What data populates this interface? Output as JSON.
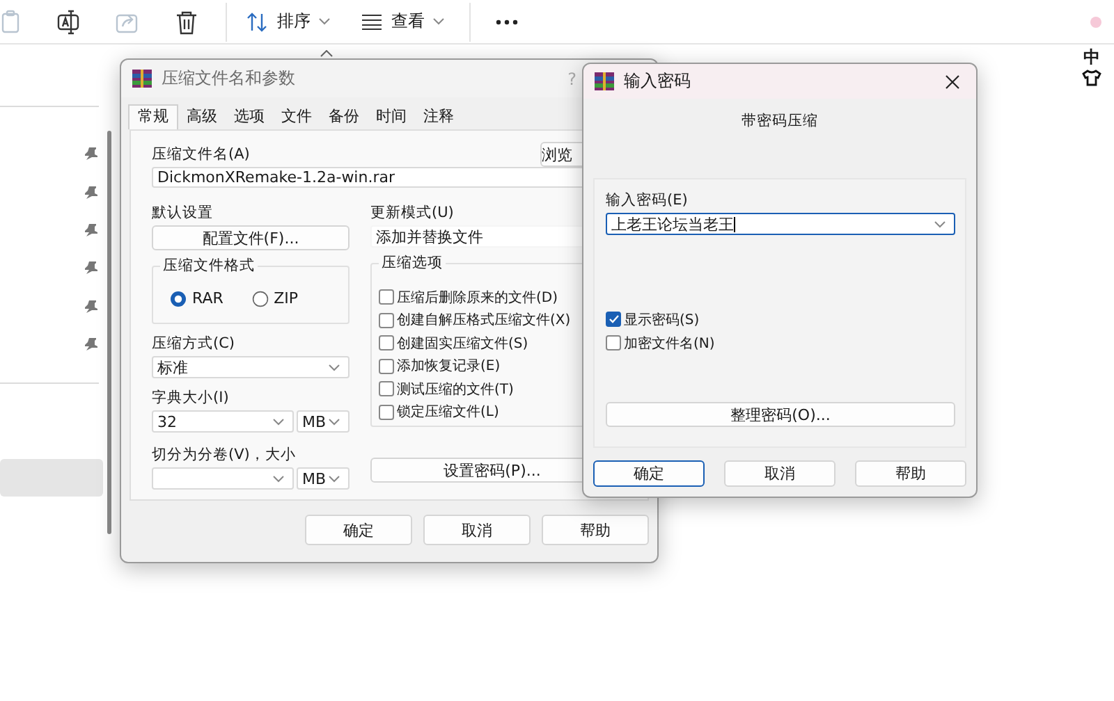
{
  "explorer": {
    "toolbar": {
      "buttons": [
        {
          "kind": "paste",
          "disabled": true
        },
        {
          "kind": "rename",
          "disabled": false
        },
        {
          "kind": "share",
          "disabled": true
        },
        {
          "kind": "delete",
          "disabled": false
        }
      ],
      "sort": "排序",
      "view": "查看"
    },
    "nav_pane": {
      "pinned_items": [
        {
          "pinned": true
        },
        {
          "pinned": true
        },
        {
          "pinned": true
        },
        {
          "pinned": true
        },
        {
          "pinned": true
        },
        {
          "pinned": true
        }
      ],
      "items": [
        {
          "selected": false
        },
        {
          "selected": false
        },
        {
          "selected": true
        }
      ]
    },
    "ime_indicator": "中"
  },
  "archive_dialog": {
    "title": "压缩文件名和参数",
    "help_mark": "?",
    "tabs": [
      {
        "label": "常规",
        "selected": true
      },
      {
        "label": "高级",
        "selected": false
      },
      {
        "label": "选项",
        "selected": false
      },
      {
        "label": "文件",
        "selected": false
      },
      {
        "label": "备份",
        "selected": false
      },
      {
        "label": "时间",
        "selected": false
      },
      {
        "label": "注释",
        "selected": false
      }
    ],
    "archive_name": {
      "label": "压缩文件名(A)",
      "value": "DickmonXRemake-1.2a-win.rar",
      "browse": "浏览"
    },
    "default_settings": {
      "label": "默认设置",
      "button": "配置文件(F)..."
    },
    "update_mode": {
      "label": "更新模式(U)",
      "value": "添加并替换文件"
    },
    "archive_format": {
      "title": "压缩文件格式",
      "options": [
        {
          "label": "RAR",
          "selected": true
        },
        {
          "label": "ZIP",
          "selected": false
        }
      ]
    },
    "method": {
      "label": "压缩方式(C)",
      "value": "标准"
    },
    "dictionary": {
      "label": "字典大小(I)",
      "value": "32",
      "unit": "MB"
    },
    "split": {
      "label": "切分为分卷(V)，大小",
      "unit": "MB"
    },
    "options": {
      "title": "压缩选项",
      "items": [
        {
          "label": "压缩后删除原来的文件(D)",
          "checked": false
        },
        {
          "label": "创建自解压格式压缩文件(X)",
          "checked": false
        },
        {
          "label": "创建固实压缩文件(S)",
          "checked": false
        },
        {
          "label": "添加恢复记录(E)",
          "checked": false
        },
        {
          "label": "测试压缩的文件(T)",
          "checked": false
        },
        {
          "label": "锁定压缩文件(L)",
          "checked": false
        }
      ]
    },
    "set_password_button": "设置密码(P)...",
    "buttons": [
      {
        "label": "确定",
        "default": false
      },
      {
        "label": "取消",
        "default": false
      },
      {
        "label": "帮助",
        "default": false
      }
    ]
  },
  "password_dialog": {
    "title": "输入密码",
    "heading": "带密码压缩",
    "password": {
      "label": "输入密码(E)",
      "value": "上老王论坛当老王"
    },
    "checkboxes": [
      {
        "label": "显示密码(S)",
        "checked": true
      },
      {
        "label": "加密文件名(N)",
        "checked": false
      }
    ],
    "organize_button": "整理密码(O)...",
    "buttons": [
      {
        "label": "确定",
        "default": true
      },
      {
        "label": "取消",
        "default": false
      },
      {
        "label": "帮助",
        "default": false
      }
    ]
  }
}
